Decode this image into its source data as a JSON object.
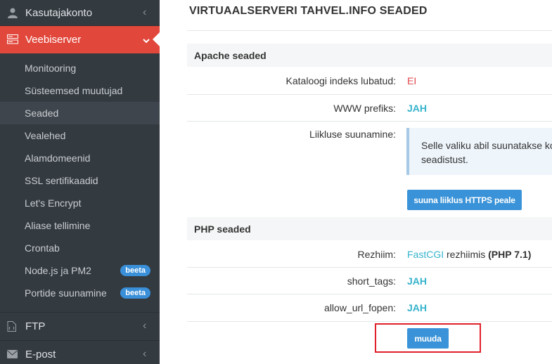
{
  "sidebar": {
    "top_item": {
      "label": "Kasutajakonto",
      "icon": "user-icon"
    },
    "active_item": {
      "label": "Veebiserver",
      "icon": "server-icon"
    },
    "subitems": [
      {
        "label": "Monitooring"
      },
      {
        "label": "Süsteemsed muutujad"
      },
      {
        "label": "Seaded"
      },
      {
        "label": "Vealehed"
      },
      {
        "label": "Alamdomeenid"
      },
      {
        "label": "SSL sertifikaadid"
      },
      {
        "label": "Let's Encrypt"
      },
      {
        "label": "Aliase tellimine"
      },
      {
        "label": "Crontab"
      },
      {
        "label": "Node.js ja PM2",
        "badge": "beeta"
      },
      {
        "label": "Portide suunamine",
        "badge": "beeta"
      }
    ],
    "bottom_items": [
      {
        "label": "FTP",
        "icon": "file-code-icon"
      },
      {
        "label": "E-post",
        "icon": "envelope-icon"
      }
    ]
  },
  "main": {
    "title": "VIRTUAALSERVERI TAHVEL.INFO SEADED",
    "apache": {
      "heading": "Apache seaded",
      "index_label": "Kataloogi indeks lubatud:",
      "index_value": "EI",
      "www_label": "WWW prefiks:",
      "www_value": "JAH",
      "redirect_label": "Liikluse suunamine:",
      "redirect_info": "Selle valiku abil suunatakse ko seadistust.",
      "redirect_button": "suuna liiklus HTTPS peale"
    },
    "php": {
      "heading": "PHP seaded",
      "mode_label": "Rezhiim:",
      "mode_link": "FastCGI",
      "mode_text": " rezhiimis ",
      "mode_version": "(PHP 7.1)",
      "short_tags_label": "short_tags:",
      "short_tags_value": "JAH",
      "url_fopen_label": "allow_url_fopen:",
      "url_fopen_value": "JAH",
      "edit_button": "muuda"
    }
  },
  "colors": {
    "sidebar_bg": "#333a40",
    "active_bg": "#e2473b",
    "accent_blue": "#3a93d8",
    "value_blue": "#35b3cc",
    "value_red": "#e2474f",
    "highlight": "#e0202a"
  }
}
